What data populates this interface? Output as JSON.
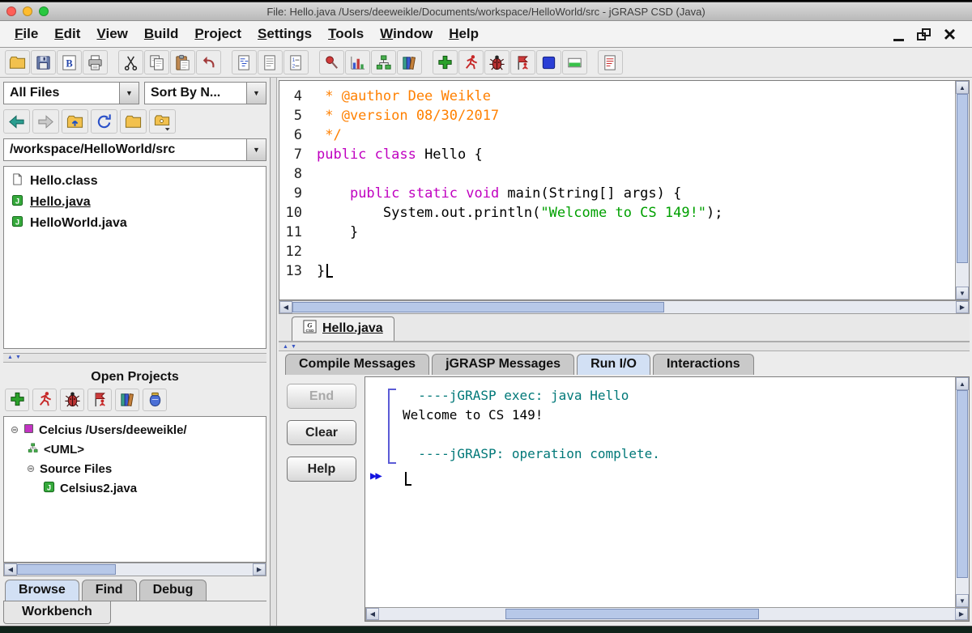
{
  "window": {
    "title": "File: Hello.java  /Users/deeweikle/Documents/workspace/HelloWorld/src - jGRASP CSD (Java)",
    "controls": {
      "close": "×"
    }
  },
  "menu": {
    "items": [
      "File",
      "Edit",
      "View",
      "Build",
      "Project",
      "Settings",
      "Tools",
      "Window",
      "Help"
    ]
  },
  "toolbar": {
    "groups": [
      [
        "open",
        "save",
        "browse-files",
        "print"
      ],
      [
        "cut",
        "copy",
        "paste",
        "undo"
      ],
      [
        "generate-csd",
        "remove-csd",
        "line-numbers"
      ],
      [
        "freeze",
        "complexity-profile",
        "uml",
        "documentation"
      ],
      [
        "compile",
        "run",
        "debug",
        "run-as-applet",
        "breakpoint",
        "step"
      ],
      [
        "messages"
      ]
    ]
  },
  "browse": {
    "filter_value": "All Files",
    "sort_value": "Sort By N...",
    "path_value": "/workspace/HelloWorld/src",
    "nav_icons": [
      "back",
      "forward",
      "up-directory",
      "refresh",
      "open-directory",
      "new-folder"
    ],
    "files": [
      {
        "name": "Hello.class",
        "icon": "file",
        "selected": false
      },
      {
        "name": "Hello.java",
        "icon": "java",
        "selected": true
      },
      {
        "name": "HelloWorld.java",
        "icon": "java",
        "selected": false
      }
    ],
    "open_projects_title": "Open Projects",
    "projects_toolbar": [
      "compile",
      "run",
      "debug",
      "run-as-applet",
      "documentation",
      "create-jar"
    ],
    "tree": [
      {
        "label": "Celcius  /Users/deeweikle/",
        "icon": "project",
        "level": 0,
        "handle": true
      },
      {
        "label": "<UML>",
        "icon": "uml-node",
        "level": 1,
        "handle": false
      },
      {
        "label": "Source Files",
        "icon": "none",
        "level": 1,
        "handle": true
      },
      {
        "label": "Celsius2.java",
        "icon": "java",
        "level": 2,
        "handle": false
      }
    ],
    "tabs": [
      {
        "label": "Browse",
        "active": true
      },
      {
        "label": "Find",
        "active": false
      },
      {
        "label": "Debug",
        "active": false
      }
    ],
    "workbench_tab": "Workbench"
  },
  "editor": {
    "tab_label": "Hello.java",
    "lines": [
      {
        "num": "4",
        "segs": [
          {
            "t": " * @author Dee Weikle",
            "c": "comment"
          }
        ]
      },
      {
        "num": "5",
        "segs": [
          {
            "t": " * @version 08/30/2017",
            "c": "comment"
          }
        ]
      },
      {
        "num": "6",
        "segs": [
          {
            "t": " */",
            "c": "comment"
          }
        ]
      },
      {
        "num": "7",
        "segs": [
          {
            "t": "public class",
            "c": "keyword"
          },
          {
            "t": " Hello {",
            "c": "plain"
          }
        ]
      },
      {
        "num": "8",
        "segs": []
      },
      {
        "num": "9",
        "segs": [
          {
            "t": "    ",
            "c": "plain"
          },
          {
            "t": "public static void",
            "c": "keyword"
          },
          {
            "t": " main(String[] args) {",
            "c": "plain"
          }
        ]
      },
      {
        "num": "10",
        "segs": [
          {
            "t": "        System.out.println(",
            "c": "plain"
          },
          {
            "t": "\"Welcome to CS 149!\"",
            "c": "string"
          },
          {
            "t": ");",
            "c": "plain"
          }
        ]
      },
      {
        "num": "11",
        "segs": [
          {
            "t": "    }",
            "c": "plain"
          }
        ]
      },
      {
        "num": "12",
        "segs": []
      },
      {
        "num": "13",
        "segs": [
          {
            "t": "}",
            "c": "plain"
          }
        ],
        "cursor": true
      }
    ]
  },
  "messages": {
    "tabs": [
      {
        "label": "Compile Messages",
        "active": false
      },
      {
        "label": "jGRASP Messages",
        "active": false
      },
      {
        "label": "Run I/O",
        "active": true
      },
      {
        "label": "Interactions",
        "active": false
      }
    ],
    "buttons": [
      {
        "label": "End",
        "disabled": true
      },
      {
        "label": "Clear",
        "disabled": false
      },
      {
        "label": "Help",
        "disabled": false
      }
    ],
    "output": [
      {
        "t": "  ----jGRASP exec: java Hello",
        "c": "jgrasp"
      },
      {
        "t": "Welcome to CS 149!",
        "c": "plain"
      },
      {
        "t": "",
        "c": "plain"
      },
      {
        "t": "  ----jGRASP: operation complete.",
        "c": "jgrasp"
      }
    ],
    "prompt_symbol": "▶▶"
  },
  "colors": {
    "comment": "#ff8000",
    "keyword": "#c000c0",
    "string": "#00a000",
    "jgrasp_teal": "#007878",
    "scrollbar_thumb": "#b7c8e8",
    "mac_close": "#ff5f57",
    "mac_minimize": "#febc2e",
    "mac_zoom": "#28c840"
  }
}
